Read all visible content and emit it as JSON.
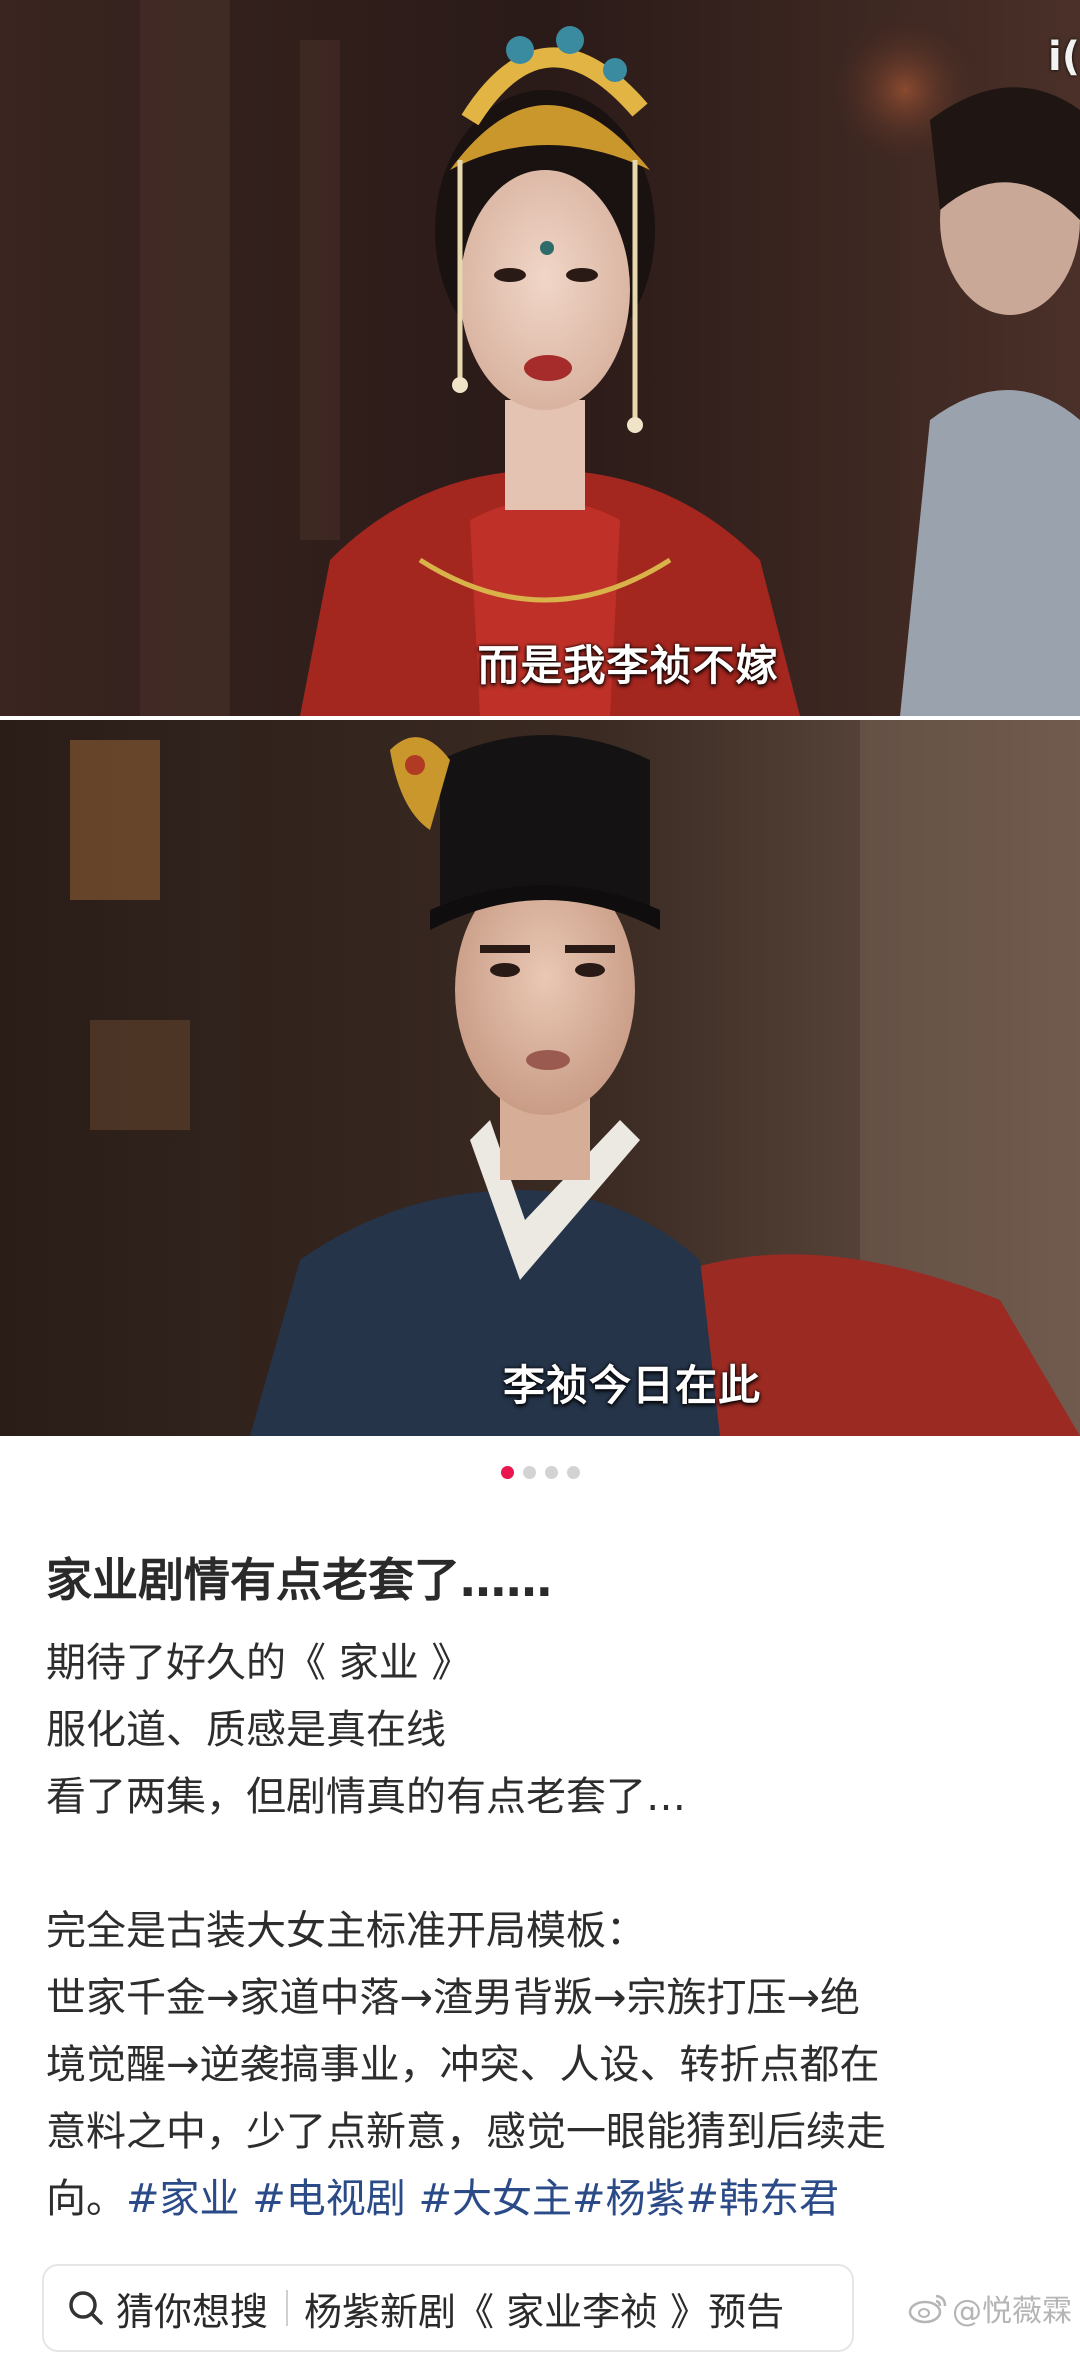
{
  "frames": [
    {
      "subtitle": "而是我李祯不嫁"
    },
    {
      "subtitle": "李祯今日在此"
    }
  ],
  "corner_label": "i(",
  "carousel": {
    "count": 4,
    "active": 0
  },
  "post": {
    "title": "家业剧情有点老套了……",
    "lines": [
      "期待了好久的《 家业 》",
      "服化道、质感是真在线",
      "看了两集，但剧情真的有点老套了…",
      "",
      "完全是古装大女主标准开局模板：",
      "世家千金→家道中落→渣男背叛→宗族打压→绝",
      "境觉醒→逆袭搞事业，冲突、人设、转折点都在",
      "意料之中，少了点新意，感觉一眼能猜到后续走"
    ],
    "last_line_prefix": "向。",
    "tags": [
      "#家业 ",
      "#电视剧 ",
      "#大女主",
      "#杨紫",
      "#韩东君"
    ]
  },
  "search": {
    "label": "猜你想搜",
    "query": "杨紫新剧《 家业李祯 》预告"
  },
  "watermark": "@悦薇霖",
  "colors": {
    "accent_dot": "#e8174d",
    "tag_link": "#2a4a88"
  }
}
